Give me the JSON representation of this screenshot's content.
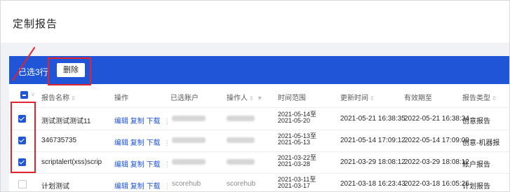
{
  "page": {
    "title": "定制报告"
  },
  "batch": {
    "selected_label": "已选3行",
    "delete_label": "删除"
  },
  "table": {
    "headers": {
      "name": "报告名称",
      "actions": "操作",
      "account": "已选账户",
      "operator": "操作人",
      "time_range": "时间范围",
      "updated": "更新时间",
      "valid_until": "有效期至",
      "type": "报告类型"
    },
    "actions": {
      "edit": "编辑",
      "copy": "复制",
      "download": "下载",
      "more": "⋮"
    },
    "rows": [
      {
        "checked": true,
        "name": "测试测试测试11",
        "range_start": "2021-05-14至",
        "range_end": "2021-05-20",
        "updated": "2021-05-21 16:38:35",
        "valid_until": "2022-05-21 16:38:34",
        "type": "创意报告"
      },
      {
        "checked": true,
        "name": "346735735",
        "range_start": "2021-05-13至",
        "range_end": "2021-05-13",
        "updated": "2021-05-14 17:09:12",
        "valid_until": "2022-05-14 17:09:09",
        "type": "创意-机器报"
      },
      {
        "checked": true,
        "name": "scriptalert(xss)scrip",
        "range_start": "2021-03-22至",
        "range_end": "2021-03-28",
        "updated": "2021-03-29 18:08:12",
        "valid_until": "2022-03-29 18:08:12",
        "type": "账户报告"
      },
      {
        "checked": false,
        "name": "计划测试",
        "account": "scorehub",
        "operator": "scorehub",
        "range_start": "2021-03-11至",
        "range_end": "2021-03-17",
        "updated": "2021-03-18 16:23:43",
        "valid_until": "2022-03-18 16:05:26",
        "type": "计划报告"
      }
    ]
  },
  "annotations": {
    "color": "#e3242b"
  },
  "colors": {
    "primary": "#1f55d6",
    "background": "#f0f2f5"
  },
  "icons": {
    "sort": "sort-caret-icon",
    "filter": "filter-icon",
    "chevron": "chevron-down-icon",
    "more": "more-vertical-icon"
  }
}
